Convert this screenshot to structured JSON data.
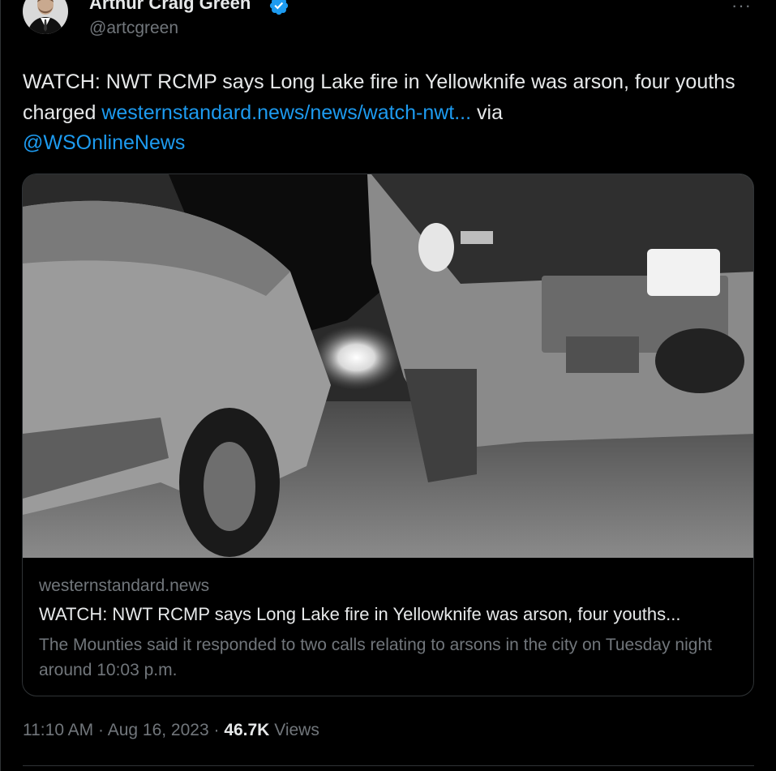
{
  "author": {
    "name": "Arthur Craig Green",
    "handle": "@artcgreen",
    "verified": true
  },
  "tweet": {
    "text_before_link": "WATCH: NWT RCMP says Long Lake fire in Yellowknife was arson, four youths charged ",
    "link_text": "westernstandard.news/news/watch-nwt...",
    "text_after_link": " via ",
    "mention": "@WSOnlineNews"
  },
  "card": {
    "domain": "westernstandard.news",
    "title": "WATCH: NWT RCMP says Long Lake fire in Yellowknife was arson, four youths...",
    "description": "The Mounties said it responded to two calls relating to arsons in the city on Tuesday night around 10:03 p.m."
  },
  "meta": {
    "time": "11:10 AM",
    "separator": " · ",
    "date": "Aug 16, 2023",
    "views_count": "46.7K",
    "views_label": " Views"
  },
  "colors": {
    "background": "#000000",
    "text": "#e7e9ea",
    "muted": "#71767b",
    "link": "#1d9bf0",
    "border": "#2f3336"
  },
  "icons": {
    "verified": "verified-badge-icon",
    "more": "more-horizontal-icon"
  }
}
